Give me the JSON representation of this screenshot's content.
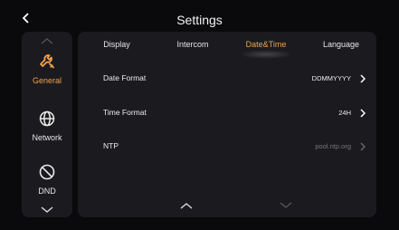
{
  "header": {
    "title": "Settings"
  },
  "sidebar": {
    "items": [
      {
        "label": "General",
        "icon": "wrench-icon",
        "active": true
      },
      {
        "label": "Network",
        "icon": "globe-icon",
        "active": false
      },
      {
        "label": "DND",
        "icon": "do-not-disturb-icon",
        "active": false
      }
    ]
  },
  "tabs": [
    {
      "label": "Display",
      "active": false
    },
    {
      "label": "Intercom",
      "active": false
    },
    {
      "label": "Date&Time",
      "active": true
    },
    {
      "label": "Language",
      "active": false
    }
  ],
  "settings": [
    {
      "label": "Date Format",
      "value": "DDMMYYYY",
      "enabled": true
    },
    {
      "label": "Time Format",
      "value": "24H",
      "enabled": true
    },
    {
      "label": "NTP",
      "value": "pool.ntp.org",
      "enabled": false
    }
  ],
  "colors": {
    "accent": "#f0a14b",
    "panel": "#1b1b1f",
    "background": "#0a0a0c"
  }
}
